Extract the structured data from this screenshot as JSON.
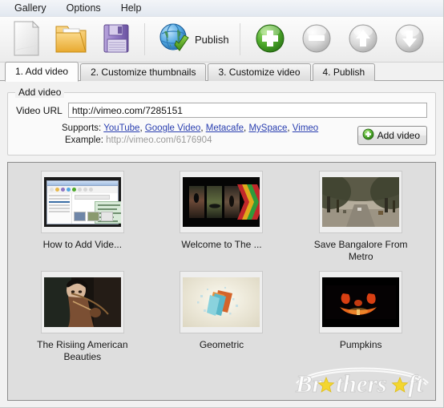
{
  "menu": {
    "items": [
      {
        "label": "Gallery",
        "name": "menu-gallery"
      },
      {
        "label": "Options",
        "name": "menu-options"
      },
      {
        "label": "Help",
        "name": "menu-help"
      }
    ]
  },
  "toolbar": {
    "new_tooltip": "New",
    "open_tooltip": "Open",
    "save_tooltip": "Save",
    "publish_label": "Publish",
    "add_tooltip": "Add",
    "remove_tooltip": "Remove",
    "up_tooltip": "Move up",
    "down_tooltip": "Move down",
    "icons": {
      "new": "new-document-icon",
      "open": "open-folder-icon",
      "save": "floppy-disk-save-icon",
      "publish": "globe-check-icon",
      "add": "green-plus-icon",
      "remove": "gray-minus-icon",
      "up": "gray-up-arrow-icon",
      "down": "gray-down-arrow-icon"
    }
  },
  "tabs": [
    {
      "label": "1. Add video",
      "active": true
    },
    {
      "label": "2. Customize thumbnails",
      "active": false
    },
    {
      "label": "3. Customize video",
      "active": false
    },
    {
      "label": "4. Publish",
      "active": false
    }
  ],
  "add_video": {
    "group_title": "Add video",
    "url_label": "Video URL",
    "url_value": "http://vimeo.com/7285151",
    "url_placeholder": "http://",
    "supports_label": "Supports:",
    "supports_links": [
      "YouTube",
      "Google Video",
      "Metacafe",
      "MySpace",
      "Vimeo"
    ],
    "example_label": "Example:",
    "example_value": "http://vimeo.com/6176904",
    "add_button_label": "Add video",
    "link_color": "#2a3fb0"
  },
  "thumbnails": [
    {
      "caption": "How to Add Vide...",
      "art": "art-screenshot",
      "name": "thumbnail-how-to-add-video"
    },
    {
      "caption": "Welcome to The ...",
      "art": "art-sports",
      "name": "thumbnail-welcome-to-the"
    },
    {
      "caption": "Save Bangalore From Metro",
      "art": "art-avenue",
      "name": "thumbnail-save-bangalore-from-metro"
    },
    {
      "caption": "The Risiing American Beauties",
      "art": "art-archer",
      "name": "thumbnail-the-risiing-american-beauties"
    },
    {
      "caption": "Geometric",
      "art": "art-geo",
      "name": "thumbnail-geometric"
    },
    {
      "caption": "Pumpkins",
      "art": "art-pumpkin",
      "name": "thumbnail-pumpkins"
    }
  ],
  "watermark": {
    "text": "Brothersoft",
    "part1": "Br",
    "part2": "thers",
    "part3": "ft"
  }
}
